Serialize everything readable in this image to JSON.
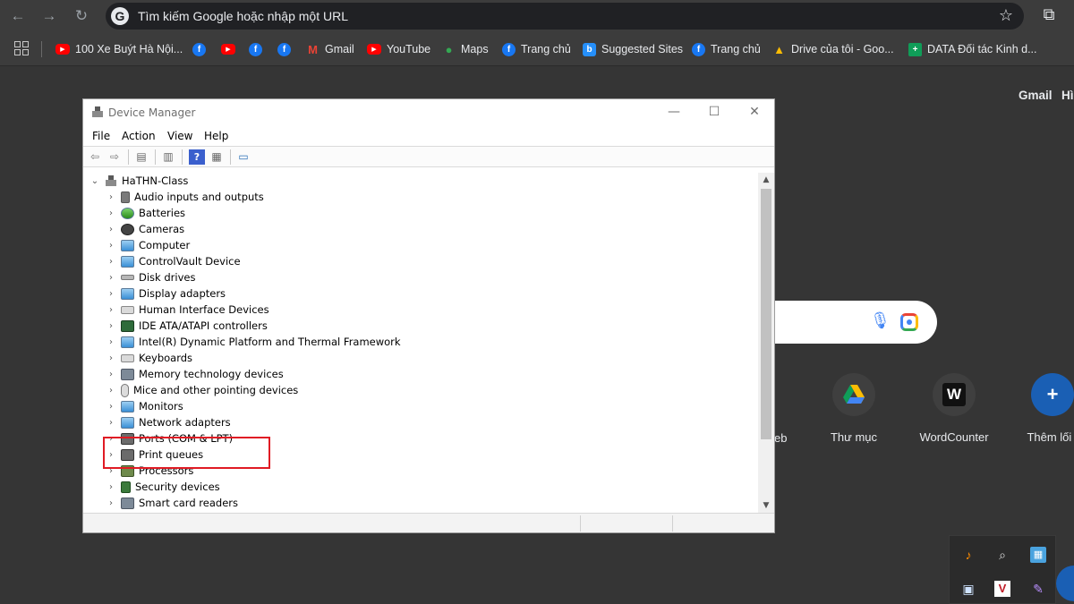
{
  "browser": {
    "omnibox_placeholder": "Tìm kiếm Google hoặc nhập một URL",
    "google_letter": "G",
    "bookmarks": [
      {
        "label": "100 Xe Buýt Hà Nội...",
        "icon": "youtube-icon"
      },
      {
        "label": "",
        "icon": "facebook-icon"
      },
      {
        "label": "",
        "icon": "youtube-icon"
      },
      {
        "label": "",
        "icon": "facebook-icon"
      },
      {
        "label": "",
        "icon": "facebook-icon"
      },
      {
        "label": "Gmail",
        "icon": "gmail-icon"
      },
      {
        "label": "YouTube",
        "icon": "youtube-icon"
      },
      {
        "label": "Maps",
        "icon": "maps-icon"
      },
      {
        "label": "Trang chủ",
        "icon": "facebook-icon"
      },
      {
        "label": "Suggested Sites",
        "icon": "bing-icon"
      },
      {
        "label": "Trang chủ",
        "icon": "facebook-icon"
      },
      {
        "label": "Drive của tôi - Goo...",
        "icon": "drive-icon"
      },
      {
        "label": "DATA Đối tác Kinh d...",
        "icon": "sheets-icon"
      }
    ]
  },
  "ntp": {
    "gmail_link": "Gmail",
    "images_link": "Hì",
    "web_label": "eb",
    "shortcuts": [
      {
        "label": "Thư mục",
        "icon": "drive-icon"
      },
      {
        "label": "WordCounter",
        "icon": "W"
      },
      {
        "label": "Thêm lối t",
        "icon": "+"
      }
    ]
  },
  "device_manager": {
    "title": "Device Manager",
    "menu": [
      "File",
      "Action",
      "View",
      "Help"
    ],
    "root": "HaTHN-Class",
    "nodes": [
      "Audio inputs and outputs",
      "Batteries",
      "Cameras",
      "Computer",
      "ControlVault Device",
      "Disk drives",
      "Display adapters",
      "Human Interface Devices",
      "IDE ATA/ATAPI controllers",
      "Intel(R) Dynamic Platform and Thermal Framework",
      "Keyboards",
      "Memory technology devices",
      "Mice and other pointing devices",
      "Monitors",
      "Network adapters",
      "Ports (COM & LPT)",
      "Print queues",
      "Processors",
      "Security devices",
      "Smart card readers"
    ]
  },
  "colors": {
    "highlight": "#e01b24",
    "browser_bg": "#353535",
    "window_bg": "#ffffff"
  }
}
